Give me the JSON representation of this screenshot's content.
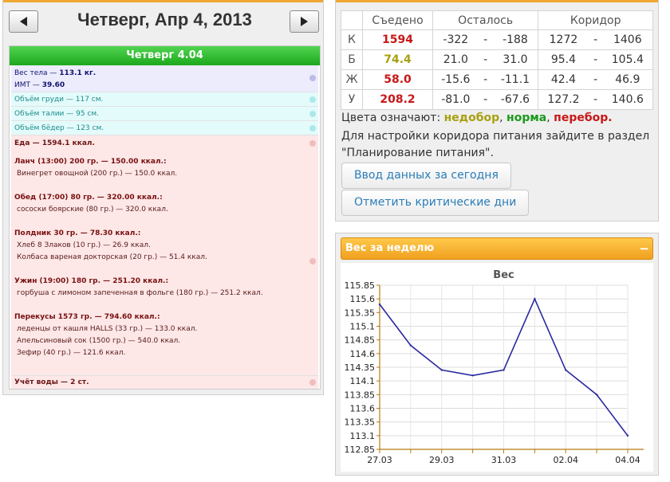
{
  "left": {
    "date_title": "Четверг, Апр 4, 2013",
    "day_header": "Четверг 4.04",
    "body": {
      "weight_label": "Вес тела — ",
      "weight_value": "113.1 кг.",
      "bmi_label": "ИМТ — ",
      "bmi_value": "39.60"
    },
    "measurements": [
      "Объём груди — 117 см.",
      "Объём талии — 95 см.",
      "Объём бёдер — 123 см."
    ],
    "food_total": "Еда — 1594.1 ккал.",
    "meals": [
      {
        "title": "Ланч (13:00) 200 гр. — 150.00 ккал.:",
        "items": [
          "Винегрет овощной (200 гр.) — 150.0 ккал."
        ]
      },
      {
        "title": "Обед (17:00) 80 гр. — 320.00 ккал.:",
        "items": [
          "сососки боярские (80 гр.) — 320.0 ккал."
        ]
      },
      {
        "title": "Полдник 30 гр. — 78.30 ккал.:",
        "items": [
          "Хлеб 8 Злаков (10 гр.) — 26.9 ккал.",
          "Колбаса вареная докторская (20 гр.) — 51.4 ккал."
        ]
      },
      {
        "title": "Ужин (19:00) 180 гр. — 251.20 ккал.:",
        "items": [
          "горбуша с лимоном запеченная в фольге (180 гр.) — 251.2 ккал."
        ]
      },
      {
        "title": "Перекусы 1573 гр. — 794.60 ккал.:",
        "items": [
          "леденцы от кашля HALLS (33 гр.) — 133.0 ккал.",
          "Апельсиновый сок (1500 гр.) — 540.0 ккал.",
          "Зефир (40 гр.) — 121.6 ккал."
        ]
      }
    ],
    "water": "Учёт воды — 2 ст."
  },
  "nutrition": {
    "headers": {
      "eaten": "Съедено",
      "left": "Осталось",
      "corridor": "Коридор"
    },
    "rows": [
      {
        "letter": "К",
        "eaten": "1594",
        "color": "#c81818",
        "left_min": "-322",
        "left_max": "-188",
        "corr_min": "1272",
        "corr_max": "1406"
      },
      {
        "letter": "Б",
        "eaten": "74.4",
        "color": "#a8a010",
        "left_min": "21.0",
        "left_max": "31.0",
        "corr_min": "95.4",
        "corr_max": "105.4"
      },
      {
        "letter": "Ж",
        "eaten": "58.0",
        "color": "#c81818",
        "left_min": "-15.6",
        "left_max": "-11.1",
        "corr_min": "42.4",
        "corr_max": "46.9"
      },
      {
        "letter": "У",
        "eaten": "208.2",
        "color": "#c81818",
        "left_min": "-81.0",
        "left_max": "-67.6",
        "corr_min": "127.2",
        "corr_max": "140.6"
      }
    ],
    "dash": "-",
    "legend": {
      "prefix": "Цвета означают: ",
      "w1": "недобор",
      "sep1": ", ",
      "w2": "норма",
      "sep2": ", ",
      "w3": "перебор",
      "end": "."
    },
    "hint": "Для настройки коридора питания зайдите в раздел \"Планирование питания\".",
    "btn_today": "Ввод данных за сегодня",
    "btn_critical": "Отметить критические дни"
  },
  "weight": {
    "header": "Вес за неделю",
    "collapse": "−"
  },
  "chart_data": {
    "type": "line",
    "title": "Вес",
    "xlabel": "",
    "ylabel": "",
    "x": [
      "27.03",
      "28.03",
      "29.03",
      "30.03",
      "31.03",
      "01.04",
      "02.04",
      "03.04",
      "04.04"
    ],
    "x_tick_labels": [
      "27.03",
      "29.03",
      "31.03",
      "02.04",
      "04.04"
    ],
    "series": [
      {
        "values": [
          115.5,
          114.75,
          114.3,
          114.2,
          114.3,
          115.6,
          114.3,
          113.85,
          113.1
        ]
      }
    ],
    "ylim": [
      112.85,
      115.85
    ],
    "yticks": [
      "112.85",
      "113.1",
      "113.35",
      "113.6",
      "113.85",
      "114.1",
      "114.35",
      "114.6",
      "114.85",
      "115.1",
      "115.35",
      "115.6",
      "115.85"
    ],
    "grid": true,
    "line_color": "#2a2aa0",
    "axis_color": "#b87a10"
  }
}
